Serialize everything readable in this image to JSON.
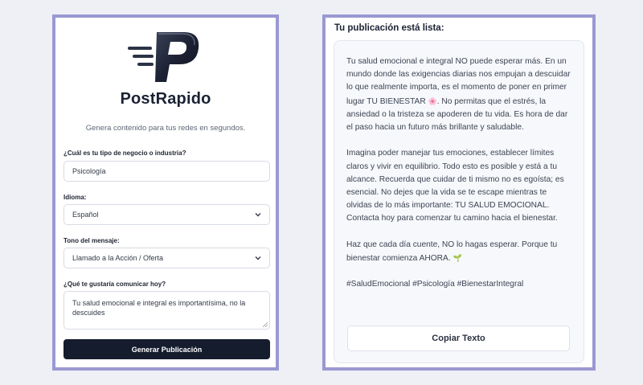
{
  "brand": {
    "logo_icon": "postrapido-logo",
    "name": "PostRapido",
    "tagline": "Genera contenido para tus redes en segundos."
  },
  "form": {
    "business": {
      "label": "¿Cuál es tu tipo de negocio o industria?",
      "value": "Psicología"
    },
    "language": {
      "label": "Idioma:",
      "value": "Español"
    },
    "tone": {
      "label": "Tono del mensaje:",
      "value": "Llamado a la Acción / Oferta"
    },
    "message": {
      "label": "¿Qué te gustaría comunicar hoy?",
      "value": "Tu salud emocional e integral es importantísima, no la descuides"
    },
    "submit_label": "Generar Publicación"
  },
  "result": {
    "title": "Tu publicación está lista:",
    "paragraphs": [
      "Tu salud emocional e integral NO puede esperar más. En un mundo donde las exigencias diarias nos empujan a descuidar lo que realmente importa, es el momento de poner en primer lugar TU BIENESTAR",
      ". No permitas que el estrés, la ansiedad o la tristeza se apoderen de tu vida. Es hora de dar el paso hacia un futuro más brillante y saludable.",
      "Imagina poder manejar tus emociones, establecer límites claros y vivir en equilibrio. Todo esto es posible y está a tu alcance. Recuerda que cuidar de ti mismo no es egoísta; es esencial. No dejes que la vida se te escape mientras te olvidas de lo más importante: TU SALUD EMOCIONAL. Contacta hoy para comenzar tu camino hacia el bienestar.",
      "Haz que cada día cuente, NO lo hagas esperar. Porque tu bienestar comienza AHORA.",
      "#SaludEmocional #Psicología #BienestarIntegral"
    ],
    "emoji_1": "🌸",
    "emoji_2": "🌱",
    "copy_label": "Copiar Texto"
  },
  "colors": {
    "accent_border": "#9a98d2",
    "primary_button": "#141c2e",
    "page_background": "#eef0f6"
  }
}
